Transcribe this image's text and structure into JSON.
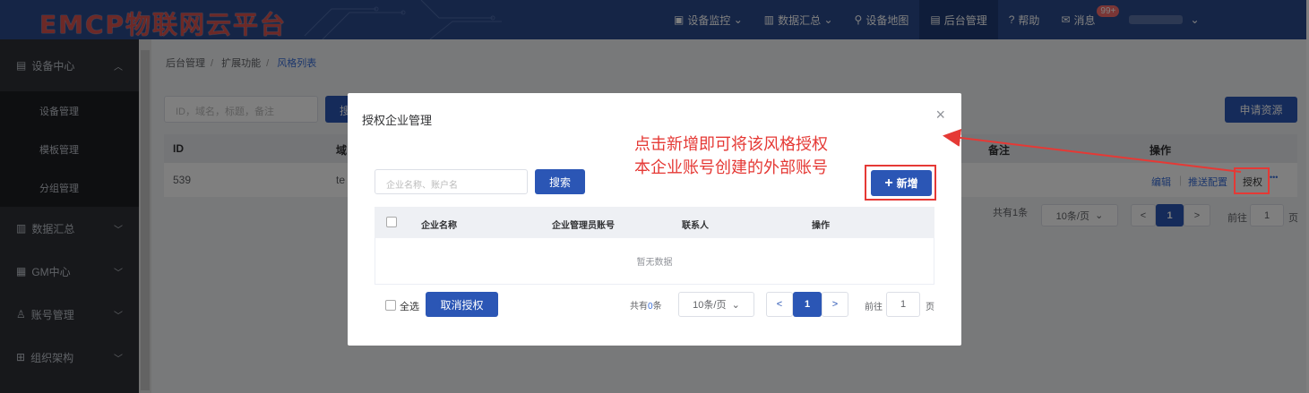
{
  "header": {
    "logo_text": "EMCP物联网云平台",
    "nav": [
      {
        "icon": "monitor-icon",
        "label": "设备监控",
        "chevron": "⌄"
      },
      {
        "icon": "chart-icon",
        "label": "数据汇总",
        "chevron": "⌄"
      },
      {
        "icon": "map-pin-icon",
        "label": "设备地图"
      },
      {
        "icon": "admin-icon",
        "label": "后台管理"
      },
      {
        "icon": "help-icon",
        "label": "帮助"
      },
      {
        "icon": "message-icon",
        "label": "消息"
      }
    ],
    "message_badge": "99+"
  },
  "sidebar": {
    "groups": [
      {
        "label": "设备中心",
        "expanded": true
      },
      {
        "label": "数据汇总"
      },
      {
        "label": "GM中心"
      },
      {
        "label": "账号管理"
      },
      {
        "label": "组织架构"
      }
    ],
    "device_items": [
      "设备管理",
      "模板管理",
      "分组管理"
    ]
  },
  "breadcrumb": [
    "后台管理",
    "扩展功能",
    "风格列表"
  ],
  "main": {
    "search_placeholder": "ID，域名，标题，备注",
    "search_btn": "搜",
    "apply_btn": "申请资源",
    "columns": {
      "id": "ID",
      "domain": "域",
      "remark": "备注",
      "ops": "操作"
    },
    "row": {
      "id": "539",
      "domain": "te",
      "edit": "编辑",
      "push": "推送配置",
      "auth": "授权",
      "more": "•••"
    },
    "pager": {
      "total": "共有1条",
      "size": "10条/页",
      "prev": "<",
      "page": "1",
      "next": ">",
      "goto": "前往",
      "goto_val": "1",
      "unit": "页"
    }
  },
  "modal": {
    "title": "授权企业管理",
    "close": "×",
    "search_placeholder": "企业名称、账户名",
    "search_btn": "搜索",
    "add_btn": "新增",
    "columns": [
      "企业名称",
      "企业管理员账号",
      "联系人",
      "操作"
    ],
    "empty": "暂无数据",
    "select_all": "全选",
    "cancel_auth": "取消授权",
    "pager": {
      "total_prefix": "共有",
      "total_count": "0",
      "total_suffix": "条",
      "size": "10条/页",
      "prev": "<",
      "page": "1",
      "next": ">",
      "goto": "前往",
      "goto_val": "1",
      "unit": "页"
    }
  },
  "annotation": {
    "line1": "点击新增即可将该风格授权",
    "line2": "本企业账号创建的外部账号"
  }
}
